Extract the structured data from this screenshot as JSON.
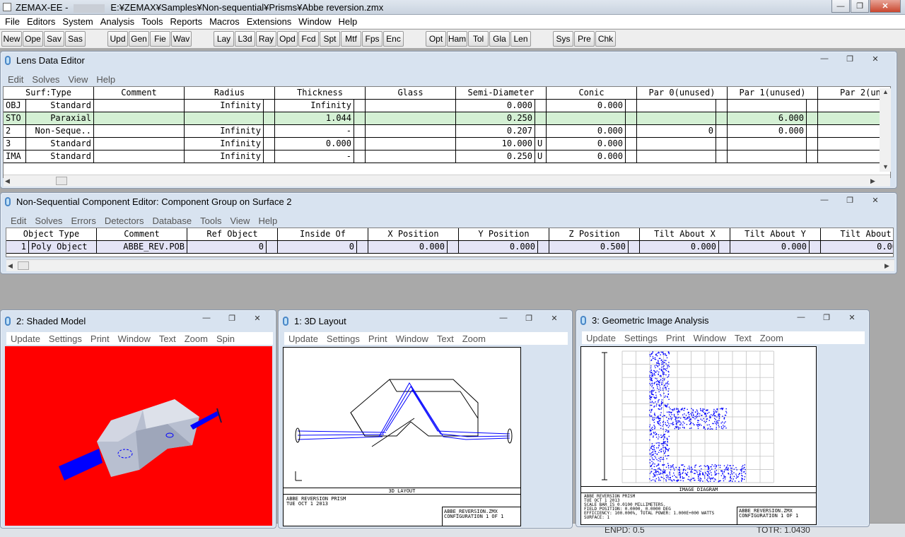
{
  "app": {
    "title_prefix": "ZEMAX-EE -",
    "title_path": "E:¥ZEMAX¥Samples¥Non-sequential¥Prisms¥Abbe reversion.zmx"
  },
  "menu": [
    "File",
    "Editors",
    "System",
    "Analysis",
    "Tools",
    "Reports",
    "Macros",
    "Extensions",
    "Window",
    "Help"
  ],
  "toolbar": [
    "New",
    "Ope",
    "Sav",
    "Sas",
    "Upd",
    "Gen",
    "Fie",
    "Wav",
    "Lay",
    "L3d",
    "Ray",
    "Opd",
    "Fcd",
    "Spt",
    "Mtf",
    "Fps",
    "Enc",
    "Opt",
    "Ham",
    "Tol",
    "Gla",
    "Len",
    "Sys",
    "Pre",
    "Chk"
  ],
  "lde": {
    "title": "Lens Data Editor",
    "menu": [
      "Edit",
      "Solves",
      "View",
      "Help"
    ],
    "headers": [
      "Surf:Type",
      "Comment",
      "Radius",
      "Thickness",
      "Glass",
      "Semi-Diameter",
      "Conic",
      "Par 0(unused)",
      "Par 1(unused)",
      "Par 2(unu"
    ],
    "rows": [
      [
        "OBJ",
        "Standard",
        "",
        "Infinity",
        "Infinity",
        "",
        "0.000",
        "",
        "0.000",
        "",
        "",
        ""
      ],
      [
        "STO",
        "Paraxial",
        "",
        "",
        "1.044",
        "",
        "0.250",
        "",
        "",
        "",
        "6.000",
        ""
      ],
      [
        "2",
        "Non-Seque..",
        "",
        "Infinity",
        "-",
        "",
        "0.207",
        "",
        "0.000",
        "0",
        "0.000",
        "0."
      ],
      [
        "3",
        "Standard",
        "",
        "Infinity",
        "0.000",
        "",
        "10.000",
        "U",
        "0.000",
        "",
        "",
        ""
      ],
      [
        "IMA",
        "Standard",
        "",
        "Infinity",
        "-",
        "",
        "0.250",
        "U",
        "0.000",
        "",
        "",
        ""
      ]
    ]
  },
  "ncg": {
    "title": "Non-Sequential Component Editor: Component Group on Surface 2",
    "menu": [
      "Edit",
      "Solves",
      "Errors",
      "Detectors",
      "Database",
      "Tools",
      "View",
      "Help"
    ],
    "headers": [
      "Object Type",
      "Comment",
      "Ref Object",
      "Inside Of",
      "X Position",
      "Y Position",
      "Z Position",
      "Tilt About X",
      "Tilt About Y",
      "Tilt About"
    ],
    "rows": [
      [
        "1",
        "Poly Object",
        "ABBE_REV.POB",
        "0",
        "0",
        "0.000",
        "0.000",
        "0.500",
        "0.000",
        "0.000",
        "0.00"
      ]
    ]
  },
  "shaded": {
    "title": "2: Shaded Model",
    "menu": [
      "Update",
      "Settings",
      "Print",
      "Window",
      "Text",
      "Zoom",
      "Spin"
    ],
    "bg": "#ff0000"
  },
  "layout": {
    "title": "1: 3D Layout",
    "menu": [
      "Update",
      "Settings",
      "Print",
      "Window",
      "Text",
      "Zoom"
    ],
    "caption": "3D LAYOUT",
    "foot_left": [
      "ABBE REVERSION PRISM",
      "TUE OCT 1 2013"
    ],
    "foot_right": [
      "ABBE_REVERSION.ZMX",
      "CONFIGURATION 1 OF 1"
    ]
  },
  "gia": {
    "title": "3: Geometric Image Analysis",
    "menu": [
      "Update",
      "Settings",
      "Print",
      "Window",
      "Text",
      "Zoom"
    ],
    "caption": "IMAGE DIAGRAM",
    "foot_left": [
      "ABBE REVERSION PRISM",
      "TUE OCT 1 2013",
      "SCALE BAR IS 0.0100 MILLIMETERS.",
      "FIELD POSITION: 0.0000, 0.0000 DEG",
      "EFFICIENCY: 100.000%, TOTAL POWER: 1.000E+000 WATTS",
      "SURFACE: 1"
    ],
    "foot_right": [
      "ABBE_REVERSION.ZMX",
      "CONFIGURATION 1 OF 1"
    ]
  },
  "status": {
    "enpd": "ENPD: 0.5",
    "totr": "TOTR: 1.0430"
  },
  "colors": {
    "ray": "#0000ff",
    "green_row": "#d4f0d4"
  }
}
